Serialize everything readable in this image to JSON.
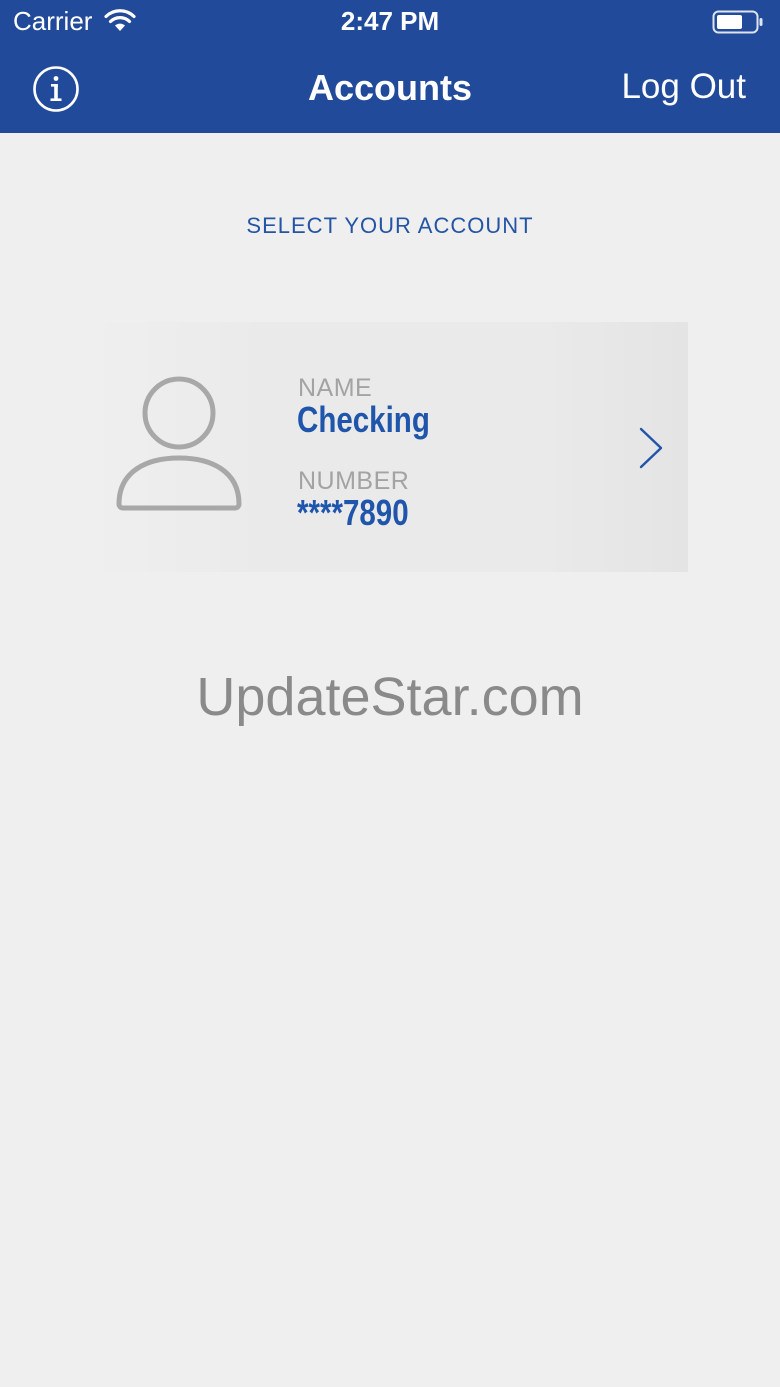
{
  "status_bar": {
    "carrier": "Carrier",
    "time": "2:47 PM",
    "wifi_icon": "wifi-icon",
    "battery_icon": "battery-icon"
  },
  "nav_bar": {
    "info_icon": "info-icon",
    "title": "Accounts",
    "logout_label": "Log Out",
    "background_color": "#214a9a"
  },
  "main": {
    "section_heading": "SELECT YOUR ACCOUNT",
    "accounts": [
      {
        "avatar_icon": "user-avatar-icon",
        "name_label": "NAME",
        "name_value": "Checking",
        "number_label": "NUMBER",
        "number_value": "****7890",
        "chevron_icon": "chevron-right-icon"
      }
    ],
    "accent_color": "#1f56ab"
  },
  "watermark": "UpdateStar.com"
}
